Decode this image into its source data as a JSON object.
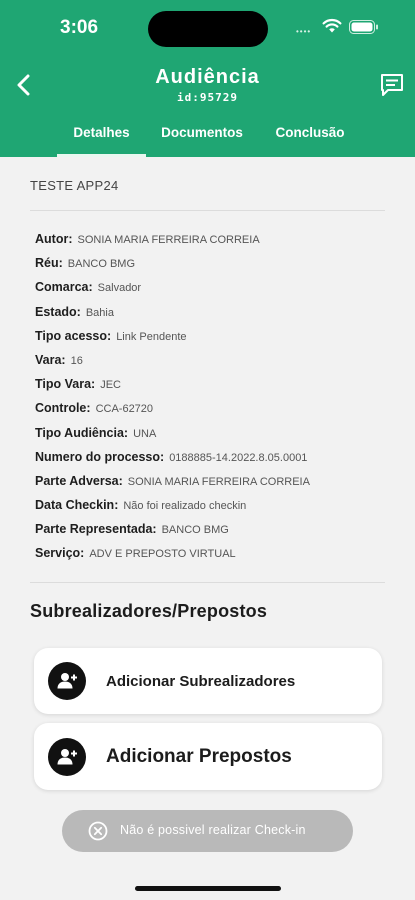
{
  "status_bar": {
    "time": "3:06",
    "signal": "••••"
  },
  "header": {
    "title": "Audiência",
    "subtitle": "id:95729",
    "tabs": [
      {
        "label": "Detalhes",
        "active": true
      },
      {
        "label": "Documentos",
        "active": false
      },
      {
        "label": "Conclusão",
        "active": false
      }
    ],
    "back_icon": "chevron-left-icon",
    "chat_icon": "chat-icon"
  },
  "case_name": "TESTE APP24",
  "details": [
    {
      "label": "Autor:",
      "value": "SONIA MARIA FERREIRA CORREIA"
    },
    {
      "label": "Réu:",
      "value": "BANCO BMG"
    },
    {
      "label": "Comarca:",
      "value": "Salvador"
    },
    {
      "label": "Estado:",
      "value": "Bahia"
    },
    {
      "label": "Tipo acesso:",
      "value": "Link Pendente"
    },
    {
      "label": "Vara:",
      "value": "16"
    },
    {
      "label": "Tipo Vara:",
      "value": "JEC"
    },
    {
      "label": "Controle:",
      "value": "CCA-62720"
    },
    {
      "label": "Tipo Audiência:",
      "value": "UNA"
    },
    {
      "label": "Numero do processo:",
      "value": "0188885-14.2022.8.05.0001"
    },
    {
      "label": "Parte Adversa:",
      "value": "SONIA MARIA FERREIRA CORREIA"
    },
    {
      "label": "Data Checkin:",
      "value": "Não foi realizado checkin"
    },
    {
      "label": "Parte Representada:",
      "value": "BANCO BMG"
    },
    {
      "label": "Serviço:",
      "value": "ADV E PREPOSTO VIRTUAL"
    }
  ],
  "section_title": "Subrealizadores/Prepostos",
  "actions": {
    "add_subrealizadores": "Adicionar Subrealizadores",
    "add_prepostos": "Adicionar Prepostos"
  },
  "toast": {
    "message": "Não é possivel realizar Check-in",
    "icon": "close-circle-icon"
  },
  "colors": {
    "brand": "#1fa673",
    "background": "#f2f2f2",
    "toast": "#b9b9b9"
  }
}
